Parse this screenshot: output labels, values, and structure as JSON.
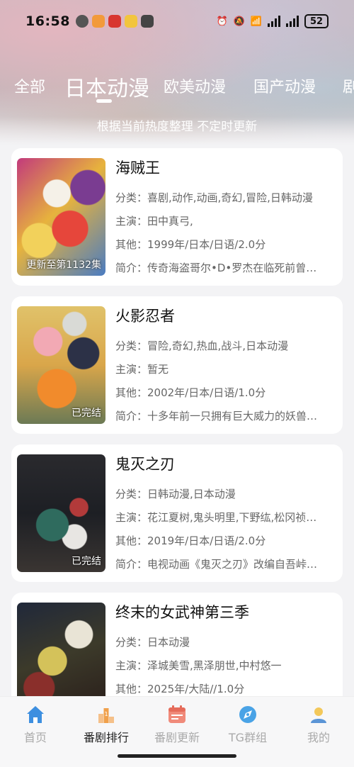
{
  "status": {
    "time": "16:58",
    "battery": "52"
  },
  "tabs": [
    {
      "label": "全部"
    },
    {
      "label": "日本动漫"
    },
    {
      "label": "欧美动漫"
    },
    {
      "label": "国产动漫"
    },
    {
      "label": "剧"
    }
  ],
  "active_tab": 1,
  "subtitle": "根据当前热度整理 不定时更新",
  "cards": [
    {
      "title": "海贼王",
      "badge": "更新至第1132集",
      "category": "分类：喜剧,动作,动画,奇幻,冒险,日韩动漫",
      "cast": "主演：田中真弓,",
      "other": "其他：1999年/日本/日语/2.0分",
      "intro": "简介：传奇海盗哥尔•D•罗杰在临死前曾…"
    },
    {
      "title": "火影忍者",
      "badge": "已完结",
      "category": "分类：冒险,奇幻,热血,战斗,日本动漫",
      "cast": "主演：暂无",
      "other": "其他：2002年/日本/日语/1.0分",
      "intro": "简介：十多年前一只拥有巨大威力的妖兽…"
    },
    {
      "title": "鬼灭之刃",
      "badge": "已完结",
      "category": "分类：日韩动漫,日本动漫",
      "cast": "主演：花江夏树,鬼头明里,下野纮,松冈祯…",
      "other": "其他：2019年/日本/日语/2.0分",
      "intro": "简介：电视动画《鬼灭之刃》改编自吾峠…"
    },
    {
      "title": "终末的女武神第三季",
      "badge": "",
      "category": "分类：日本动漫",
      "cast": "主演：泽城美雪,黑泽朋世,中村悠一",
      "other": "其他：2025年/大陆//1.0分",
      "intro": ""
    }
  ],
  "nav": [
    {
      "label": "首页",
      "icon": "home-icon"
    },
    {
      "label": "番剧排行",
      "icon": "ranking-icon"
    },
    {
      "label": "番剧更新",
      "icon": "calendar-icon"
    },
    {
      "label": "TG群组",
      "icon": "telegram-icon"
    },
    {
      "label": "我的",
      "icon": "profile-icon"
    }
  ],
  "colors": {
    "home": "#3d8fe0",
    "ranking": "#f0a04b",
    "calendar": "#f08a7a",
    "telegram": "#4aa3e6",
    "profile": "#5b95d6"
  }
}
